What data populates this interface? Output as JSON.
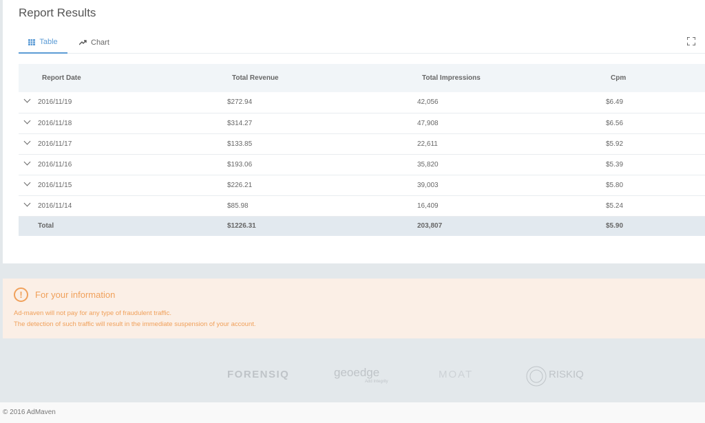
{
  "title": "Report Results",
  "tabs": [
    {
      "label": "Table",
      "icon": "grid-icon"
    },
    {
      "label": "Chart",
      "icon": "trend-icon"
    }
  ],
  "table": {
    "headers": [
      "Report Date",
      "Total Revenue",
      "Total Impressions",
      "Cpm"
    ],
    "rows": [
      [
        "2016/11/19",
        "$272.94",
        "42,056",
        "$6.49"
      ],
      [
        "2016/11/18",
        "$314.27",
        "47,908",
        "$6.56"
      ],
      [
        "2016/11/17",
        "$133.85",
        "22,611",
        "$5.92"
      ],
      [
        "2016/11/16",
        "$193.06",
        "35,820",
        "$5.39"
      ],
      [
        "2016/11/15",
        "$226.21",
        "39,003",
        "$5.80"
      ],
      [
        "2016/11/14",
        "$85.98",
        "16,409",
        "$5.24"
      ]
    ],
    "total": [
      "Total",
      "$1226.31",
      "203,807",
      "$5.90"
    ]
  },
  "info": {
    "title": "For your information",
    "line1": "Ad-maven will not pay for any type of fraudulent traffic.",
    "line2": "The detection of such traffic will result in the immediate suspension of your account."
  },
  "logos": [
    "FORENSIQ",
    "geoedge",
    "Add Integrity",
    "MOAT",
    "RISKIQ"
  ],
  "footer": "© 2016 AdMaven"
}
